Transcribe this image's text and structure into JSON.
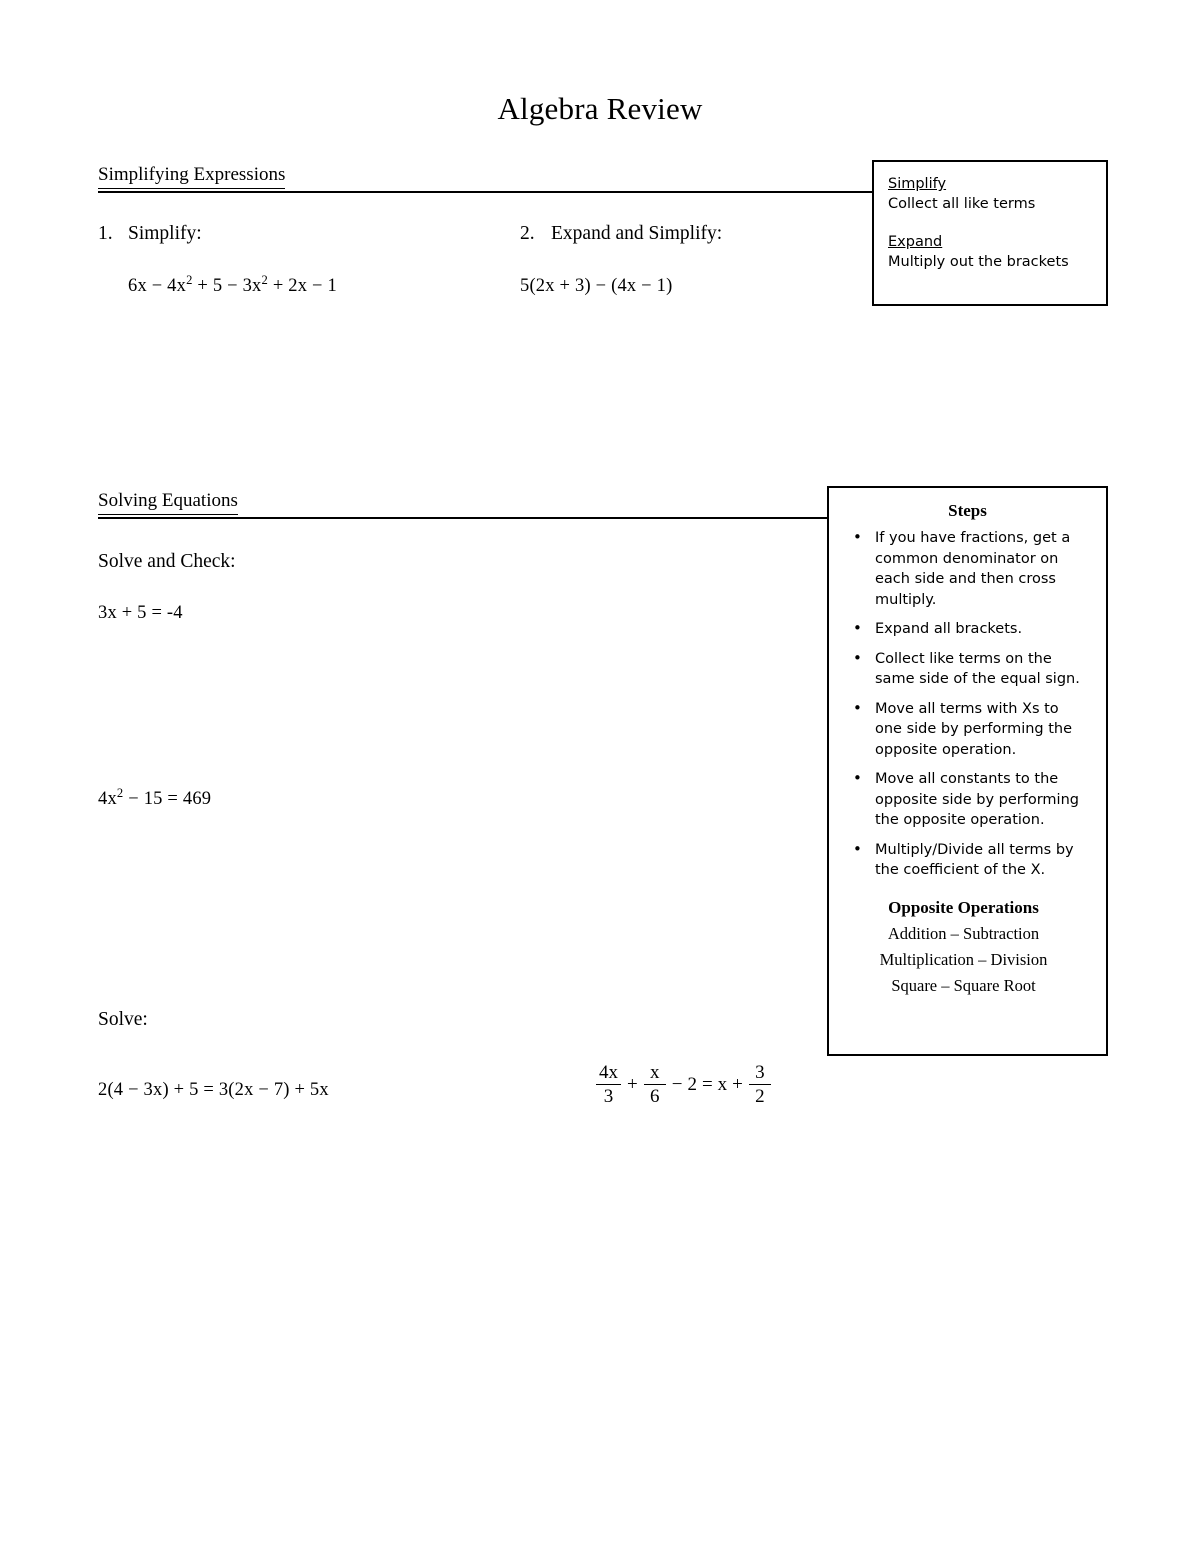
{
  "document": {
    "title": "Algebra Review"
  },
  "sections": [
    {
      "heading": "Simplifying Expressions",
      "problems": [
        {
          "number": "1.",
          "prompt": "Simplify:",
          "expression": "6x − 4x2 + 5 − 3x2 + 2x − 1"
        },
        {
          "number": "2.",
          "prompt": "Expand and Simplify:",
          "expression": "5(2x + 3) − (4x − 1)"
        }
      ]
    },
    {
      "heading": "Solving Equations",
      "prompt_solve_check": "Solve and Check:",
      "equation_1": "3x + 5 = -4",
      "equation_2": "4x2 − 15 = 469",
      "prompt_solve": "Solve:",
      "equation_3": "2(4 − 3x) + 5 = 3(2x − 7) + 5x",
      "equation_4": {
        "term1_num": "4x",
        "term1_den": "3",
        "op1": "+",
        "term2_num": "x",
        "term2_den": "6",
        "op2": "−",
        "term3": "2",
        "equals": "=",
        "rhs_var": "x",
        "op3": "+",
        "term4_num": "3",
        "term4_den": "2"
      }
    }
  ],
  "tip_box": {
    "term_1": "Simplify",
    "definition_1": "Collect all like terms",
    "term_2": "Expand",
    "definition_2": "Multiply out the brackets"
  },
  "steps_box": {
    "title": "Steps",
    "items": [
      "If you have fractions, get a common denominator on each side and then cross multiply.",
      "Expand all brackets.",
      "Collect like terms on the same side of the equal sign.",
      "Move all terms with Xs to one side by performing the opposite operation.",
      "Move all constants to the opposite side by performing the opposite operation.",
      "Multiply/Divide all terms by the coefficient of the X."
    ],
    "opposite_operations": {
      "title": "Opposite Operations",
      "pairs": [
        "Addition – Subtraction",
        "Multiplication – Division",
        "Square – Square Root"
      ]
    }
  },
  "colors": {
    "page_background": "#ffffff",
    "text": "#000000",
    "rule": "#000000",
    "box_border": "#000000"
  }
}
